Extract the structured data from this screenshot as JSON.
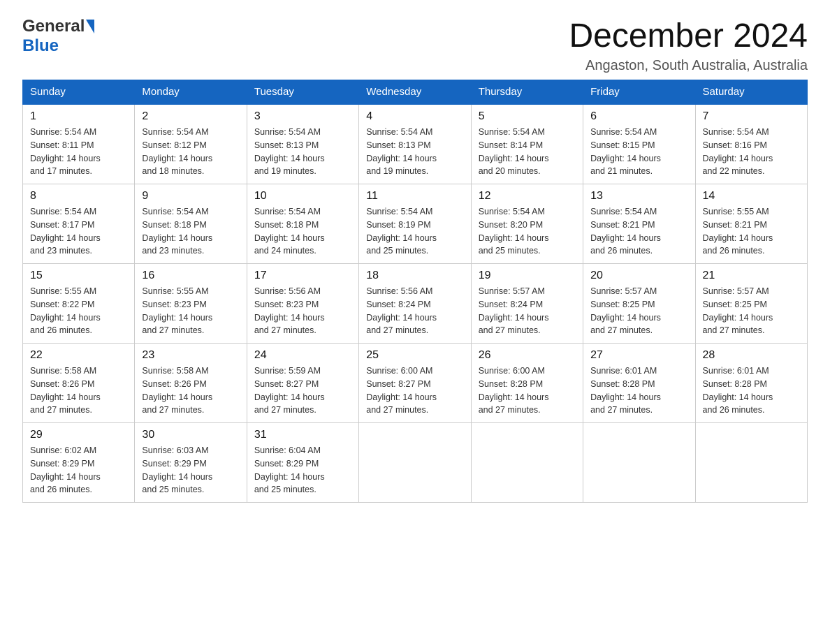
{
  "header": {
    "logo": {
      "general": "General",
      "blue": "Blue"
    },
    "title": "December 2024",
    "subtitle": "Angaston, South Australia, Australia"
  },
  "weekdays": [
    "Sunday",
    "Monday",
    "Tuesday",
    "Wednesday",
    "Thursday",
    "Friday",
    "Saturday"
  ],
  "weeks": [
    [
      {
        "day": "1",
        "sunrise": "5:54 AM",
        "sunset": "8:11 PM",
        "daylight": "14 hours and 17 minutes."
      },
      {
        "day": "2",
        "sunrise": "5:54 AM",
        "sunset": "8:12 PM",
        "daylight": "14 hours and 18 minutes."
      },
      {
        "day": "3",
        "sunrise": "5:54 AM",
        "sunset": "8:13 PM",
        "daylight": "14 hours and 19 minutes."
      },
      {
        "day": "4",
        "sunrise": "5:54 AM",
        "sunset": "8:13 PM",
        "daylight": "14 hours and 19 minutes."
      },
      {
        "day": "5",
        "sunrise": "5:54 AM",
        "sunset": "8:14 PM",
        "daylight": "14 hours and 20 minutes."
      },
      {
        "day": "6",
        "sunrise": "5:54 AM",
        "sunset": "8:15 PM",
        "daylight": "14 hours and 21 minutes."
      },
      {
        "day": "7",
        "sunrise": "5:54 AM",
        "sunset": "8:16 PM",
        "daylight": "14 hours and 22 minutes."
      }
    ],
    [
      {
        "day": "8",
        "sunrise": "5:54 AM",
        "sunset": "8:17 PM",
        "daylight": "14 hours and 23 minutes."
      },
      {
        "day": "9",
        "sunrise": "5:54 AM",
        "sunset": "8:18 PM",
        "daylight": "14 hours and 23 minutes."
      },
      {
        "day": "10",
        "sunrise": "5:54 AM",
        "sunset": "8:18 PM",
        "daylight": "14 hours and 24 minutes."
      },
      {
        "day": "11",
        "sunrise": "5:54 AM",
        "sunset": "8:19 PM",
        "daylight": "14 hours and 25 minutes."
      },
      {
        "day": "12",
        "sunrise": "5:54 AM",
        "sunset": "8:20 PM",
        "daylight": "14 hours and 25 minutes."
      },
      {
        "day": "13",
        "sunrise": "5:54 AM",
        "sunset": "8:21 PM",
        "daylight": "14 hours and 26 minutes."
      },
      {
        "day": "14",
        "sunrise": "5:55 AM",
        "sunset": "8:21 PM",
        "daylight": "14 hours and 26 minutes."
      }
    ],
    [
      {
        "day": "15",
        "sunrise": "5:55 AM",
        "sunset": "8:22 PM",
        "daylight": "14 hours and 26 minutes."
      },
      {
        "day": "16",
        "sunrise": "5:55 AM",
        "sunset": "8:23 PM",
        "daylight": "14 hours and 27 minutes."
      },
      {
        "day": "17",
        "sunrise": "5:56 AM",
        "sunset": "8:23 PM",
        "daylight": "14 hours and 27 minutes."
      },
      {
        "day": "18",
        "sunrise": "5:56 AM",
        "sunset": "8:24 PM",
        "daylight": "14 hours and 27 minutes."
      },
      {
        "day": "19",
        "sunrise": "5:57 AM",
        "sunset": "8:24 PM",
        "daylight": "14 hours and 27 minutes."
      },
      {
        "day": "20",
        "sunrise": "5:57 AM",
        "sunset": "8:25 PM",
        "daylight": "14 hours and 27 minutes."
      },
      {
        "day": "21",
        "sunrise": "5:57 AM",
        "sunset": "8:25 PM",
        "daylight": "14 hours and 27 minutes."
      }
    ],
    [
      {
        "day": "22",
        "sunrise": "5:58 AM",
        "sunset": "8:26 PM",
        "daylight": "14 hours and 27 minutes."
      },
      {
        "day": "23",
        "sunrise": "5:58 AM",
        "sunset": "8:26 PM",
        "daylight": "14 hours and 27 minutes."
      },
      {
        "day": "24",
        "sunrise": "5:59 AM",
        "sunset": "8:27 PM",
        "daylight": "14 hours and 27 minutes."
      },
      {
        "day": "25",
        "sunrise": "6:00 AM",
        "sunset": "8:27 PM",
        "daylight": "14 hours and 27 minutes."
      },
      {
        "day": "26",
        "sunrise": "6:00 AM",
        "sunset": "8:28 PM",
        "daylight": "14 hours and 27 minutes."
      },
      {
        "day": "27",
        "sunrise": "6:01 AM",
        "sunset": "8:28 PM",
        "daylight": "14 hours and 27 minutes."
      },
      {
        "day": "28",
        "sunrise": "6:01 AM",
        "sunset": "8:28 PM",
        "daylight": "14 hours and 26 minutes."
      }
    ],
    [
      {
        "day": "29",
        "sunrise": "6:02 AM",
        "sunset": "8:29 PM",
        "daylight": "14 hours and 26 minutes."
      },
      {
        "day": "30",
        "sunrise": "6:03 AM",
        "sunset": "8:29 PM",
        "daylight": "14 hours and 25 minutes."
      },
      {
        "day": "31",
        "sunrise": "6:04 AM",
        "sunset": "8:29 PM",
        "daylight": "14 hours and 25 minutes."
      },
      null,
      null,
      null,
      null
    ]
  ],
  "labels": {
    "sunrise": "Sunrise:",
    "sunset": "Sunset:",
    "daylight": "Daylight:"
  }
}
